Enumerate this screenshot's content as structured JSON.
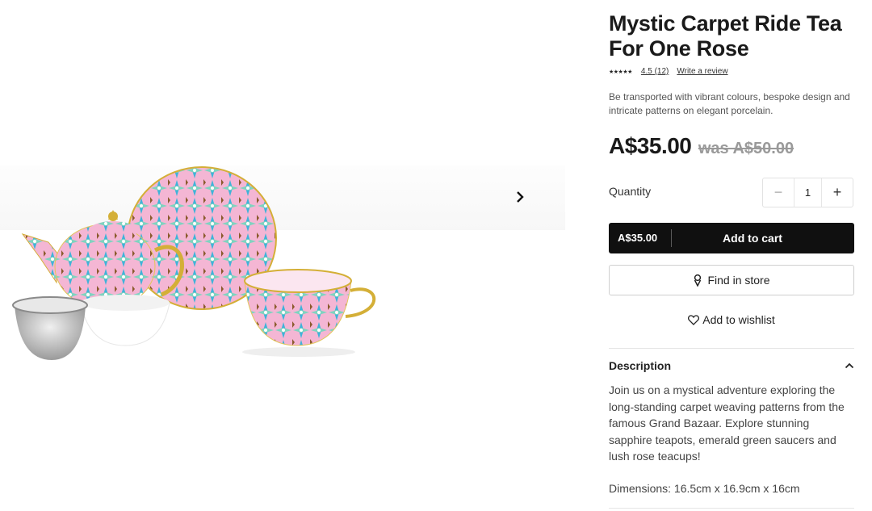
{
  "product": {
    "title": "Mystic Carpet Ride Tea For One Rose",
    "stars": "★★★★★",
    "rating": "4.5",
    "review_count": "(12)",
    "write_review": "Write a review",
    "tagline": "Be transported with vibrant colours, bespoke design and intricate patterns on elegant porcelain.",
    "price": "A$35.00",
    "was_price": "was A$50.00"
  },
  "quantity": {
    "label": "Quantity",
    "minus": "−",
    "value": "1",
    "plus": "+"
  },
  "actions": {
    "cart_price": "A$35.00",
    "add_to_cart": "Add to cart",
    "find_in_store": "Find in store",
    "wishlist": "Add to wishlist"
  },
  "description": {
    "heading": "Description",
    "body": "Join us on a mystical adventure exploring the long-standing carpet weaving patterns from the famous Grand Bazaar. Explore stunning sapphire teapots, emerald green saucers and lush rose teacups!",
    "dimensions": "Dimensions: 16.5cm x 16.9cm x 16cm"
  },
  "colors": {
    "accent": "#101010",
    "was_price": "#9a9a9a",
    "porcelain_pink": "#f4b6d4",
    "pattern_blue": "#3fb3d9",
    "gold": "#c9a227"
  },
  "icons": {
    "next": "chevron-right-icon",
    "store": "map-pin-icon",
    "wishlist": "heart-icon",
    "collapse": "chevron-up-icon"
  }
}
